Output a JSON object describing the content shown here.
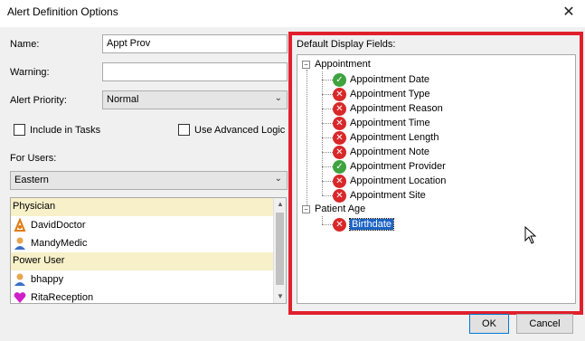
{
  "window": {
    "title": "Alert Definition Options",
    "close_icon": "close-icon"
  },
  "form": {
    "name_label": "Name:",
    "name_value": "Appt Prov",
    "warning_label": "Warning:",
    "warning_value": "",
    "priority_label": "Alert Priority:",
    "priority_value": "Normal",
    "include_tasks_label": "Include in Tasks",
    "include_tasks_checked": false,
    "advanced_logic_label": "Use Advanced Logic",
    "advanced_logic_checked": false,
    "for_users_label": "For Users:",
    "for_users_value": "Eastern"
  },
  "users": {
    "groups": [
      {
        "name": "Physician",
        "members": [
          {
            "name": "DavidDoctor",
            "icon": "doctor-icon"
          },
          {
            "name": "MandyMedic",
            "icon": "user-icon"
          }
        ]
      },
      {
        "name": "Power User",
        "members": [
          {
            "name": "bhappy",
            "icon": "user-icon"
          },
          {
            "name": "RitaReception",
            "icon": "heart-icon"
          }
        ]
      }
    ]
  },
  "display_fields": {
    "label": "Default Display Fields:",
    "tree": [
      {
        "name": "Appointment",
        "expanded": true,
        "children": [
          {
            "name": "Appointment Date",
            "state": "enabled"
          },
          {
            "name": "Appointment Type",
            "state": "disabled"
          },
          {
            "name": "Appointment Reason",
            "state": "disabled"
          },
          {
            "name": "Appointment Time",
            "state": "disabled"
          },
          {
            "name": "Appointment Length",
            "state": "disabled"
          },
          {
            "name": "Appointment Note",
            "state": "disabled"
          },
          {
            "name": "Appointment Provider",
            "state": "enabled"
          },
          {
            "name": "Appointment Location",
            "state": "disabled"
          },
          {
            "name": "Appointment Site",
            "state": "disabled"
          }
        ]
      },
      {
        "name": "Patient Age",
        "expanded": true,
        "children": [
          {
            "name": "Birthdate",
            "state": "disabled",
            "selected": true
          }
        ]
      }
    ]
  },
  "buttons": {
    "ok_label": "OK",
    "cancel_label": "Cancel"
  },
  "colors": {
    "highlight_frame": "#e0202c",
    "enabled": "#3fa33f",
    "disabled": "#d8282a",
    "group_bg": "#f7f0c8",
    "selection": "#1c63c4"
  }
}
